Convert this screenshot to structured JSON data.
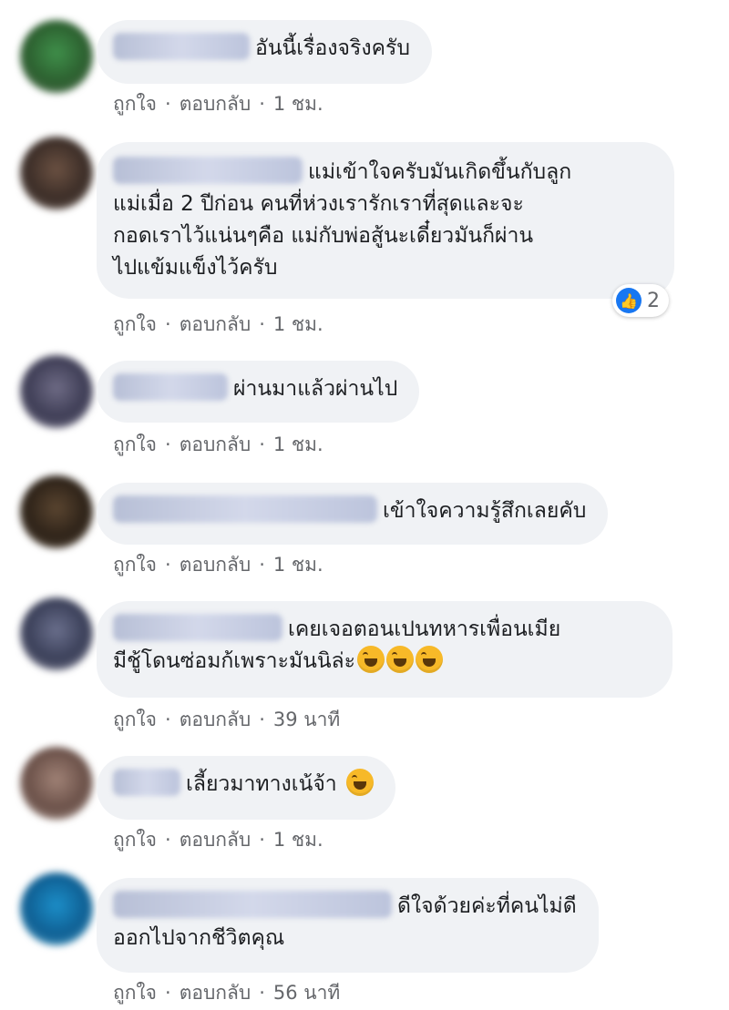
{
  "comments": [
    {
      "text": "อันนี้เรื่องจริงครับ",
      "like_label": "ถูกใจ",
      "reply_label": "ตอบกลับ",
      "time": "1 ชม."
    },
    {
      "text": "แม่เข้าใจครับมันเกิดขึ้นกับลูก\nแม่เมื่อ 2 ปีก่อน คนที่ห่วงเรารักเราที่สุดและจะ\nกอดเราไว้แน่นๆคือ แม่กับพ่อสู้นะเดี๋ยวมันก็ผ่าน\nไปแข้มแข็งไว้ครับ",
      "like_label": "ถูกใจ",
      "reply_label": "ตอบกลับ",
      "time": "1 ชม.",
      "reaction_count": "2"
    },
    {
      "text": "ผ่านมาแล้วผ่านไป",
      "like_label": "ถูกใจ",
      "reply_label": "ตอบกลับ",
      "time": "1 ชม."
    },
    {
      "text": "เข้าใจความรู้สึกเลยคับ",
      "like_label": "ถูกใจ",
      "reply_label": "ตอบกลับ",
      "time": "1 ชม."
    },
    {
      "text_line1": "เคยเจอตอนเปนทหารเพื่อนเมีย",
      "text_line2": "มีชู้โดนซ่อมก้เพราะมันนิล่ะ",
      "like_label": "ถูกใจ",
      "reply_label": "ตอบกลับ",
      "time": "39 นาที"
    },
    {
      "text": "เลี้ยวมาทางเน้จ้า",
      "like_label": "ถูกใจ",
      "reply_label": "ตอบกลับ",
      "time": "1 ชม."
    },
    {
      "text": "ดีใจด้วยค่ะที่คนไม่ดี\nออกไปจากชีวิตคุณ",
      "like_label": "ถูกใจ",
      "reply_label": "ตอบกลับ",
      "time": "56 นาที"
    }
  ],
  "separator": "·",
  "colors": {
    "bubble": "#f0f2f5",
    "meta": "#65676b",
    "like_blue": "#1877f2"
  }
}
